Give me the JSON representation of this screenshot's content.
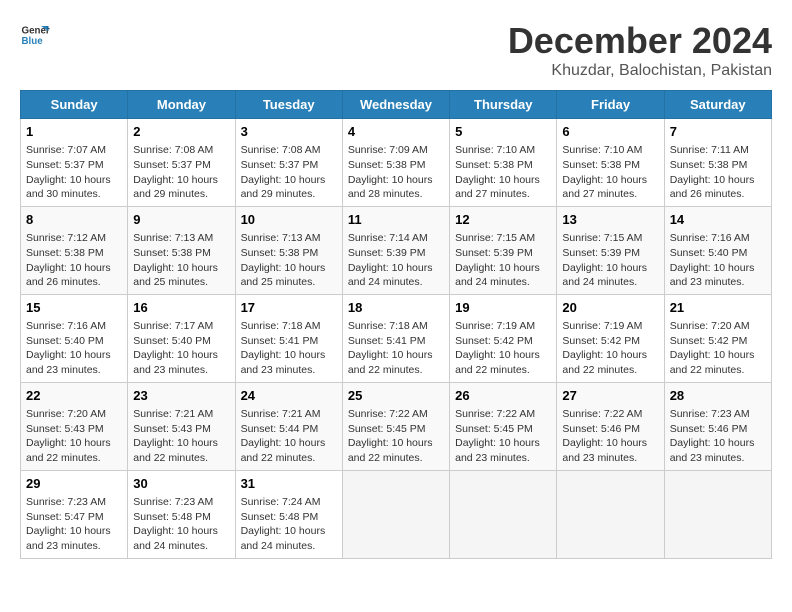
{
  "header": {
    "logo_line1": "General",
    "logo_line2": "Blue",
    "month": "December 2024",
    "location": "Khuzdar, Balochistan, Pakistan"
  },
  "weekdays": [
    "Sunday",
    "Monday",
    "Tuesday",
    "Wednesday",
    "Thursday",
    "Friday",
    "Saturday"
  ],
  "weeks": [
    [
      {
        "day": 1,
        "sunrise": "7:07 AM",
        "sunset": "5:37 PM",
        "daylight": "10 hours and 30 minutes."
      },
      {
        "day": 2,
        "sunrise": "7:08 AM",
        "sunset": "5:37 PM",
        "daylight": "10 hours and 29 minutes."
      },
      {
        "day": 3,
        "sunrise": "7:08 AM",
        "sunset": "5:37 PM",
        "daylight": "10 hours and 29 minutes."
      },
      {
        "day": 4,
        "sunrise": "7:09 AM",
        "sunset": "5:38 PM",
        "daylight": "10 hours and 28 minutes."
      },
      {
        "day": 5,
        "sunrise": "7:10 AM",
        "sunset": "5:38 PM",
        "daylight": "10 hours and 27 minutes."
      },
      {
        "day": 6,
        "sunrise": "7:10 AM",
        "sunset": "5:38 PM",
        "daylight": "10 hours and 27 minutes."
      },
      {
        "day": 7,
        "sunrise": "7:11 AM",
        "sunset": "5:38 PM",
        "daylight": "10 hours and 26 minutes."
      }
    ],
    [
      {
        "day": 8,
        "sunrise": "7:12 AM",
        "sunset": "5:38 PM",
        "daylight": "10 hours and 26 minutes."
      },
      {
        "day": 9,
        "sunrise": "7:13 AM",
        "sunset": "5:38 PM",
        "daylight": "10 hours and 25 minutes."
      },
      {
        "day": 10,
        "sunrise": "7:13 AM",
        "sunset": "5:38 PM",
        "daylight": "10 hours and 25 minutes."
      },
      {
        "day": 11,
        "sunrise": "7:14 AM",
        "sunset": "5:39 PM",
        "daylight": "10 hours and 24 minutes."
      },
      {
        "day": 12,
        "sunrise": "7:15 AM",
        "sunset": "5:39 PM",
        "daylight": "10 hours and 24 minutes."
      },
      {
        "day": 13,
        "sunrise": "7:15 AM",
        "sunset": "5:39 PM",
        "daylight": "10 hours and 24 minutes."
      },
      {
        "day": 14,
        "sunrise": "7:16 AM",
        "sunset": "5:40 PM",
        "daylight": "10 hours and 23 minutes."
      }
    ],
    [
      {
        "day": 15,
        "sunrise": "7:16 AM",
        "sunset": "5:40 PM",
        "daylight": "10 hours and 23 minutes."
      },
      {
        "day": 16,
        "sunrise": "7:17 AM",
        "sunset": "5:40 PM",
        "daylight": "10 hours and 23 minutes."
      },
      {
        "day": 17,
        "sunrise": "7:18 AM",
        "sunset": "5:41 PM",
        "daylight": "10 hours and 23 minutes."
      },
      {
        "day": 18,
        "sunrise": "7:18 AM",
        "sunset": "5:41 PM",
        "daylight": "10 hours and 22 minutes."
      },
      {
        "day": 19,
        "sunrise": "7:19 AM",
        "sunset": "5:42 PM",
        "daylight": "10 hours and 22 minutes."
      },
      {
        "day": 20,
        "sunrise": "7:19 AM",
        "sunset": "5:42 PM",
        "daylight": "10 hours and 22 minutes."
      },
      {
        "day": 21,
        "sunrise": "7:20 AM",
        "sunset": "5:42 PM",
        "daylight": "10 hours and 22 minutes."
      }
    ],
    [
      {
        "day": 22,
        "sunrise": "7:20 AM",
        "sunset": "5:43 PM",
        "daylight": "10 hours and 22 minutes."
      },
      {
        "day": 23,
        "sunrise": "7:21 AM",
        "sunset": "5:43 PM",
        "daylight": "10 hours and 22 minutes."
      },
      {
        "day": 24,
        "sunrise": "7:21 AM",
        "sunset": "5:44 PM",
        "daylight": "10 hours and 22 minutes."
      },
      {
        "day": 25,
        "sunrise": "7:22 AM",
        "sunset": "5:45 PM",
        "daylight": "10 hours and 22 minutes."
      },
      {
        "day": 26,
        "sunrise": "7:22 AM",
        "sunset": "5:45 PM",
        "daylight": "10 hours and 23 minutes."
      },
      {
        "day": 27,
        "sunrise": "7:22 AM",
        "sunset": "5:46 PM",
        "daylight": "10 hours and 23 minutes."
      },
      {
        "day": 28,
        "sunrise": "7:23 AM",
        "sunset": "5:46 PM",
        "daylight": "10 hours and 23 minutes."
      }
    ],
    [
      {
        "day": 29,
        "sunrise": "7:23 AM",
        "sunset": "5:47 PM",
        "daylight": "10 hours and 23 minutes."
      },
      {
        "day": 30,
        "sunrise": "7:23 AM",
        "sunset": "5:48 PM",
        "daylight": "10 hours and 24 minutes."
      },
      {
        "day": 31,
        "sunrise": "7:24 AM",
        "sunset": "5:48 PM",
        "daylight": "10 hours and 24 minutes."
      },
      null,
      null,
      null,
      null
    ]
  ]
}
